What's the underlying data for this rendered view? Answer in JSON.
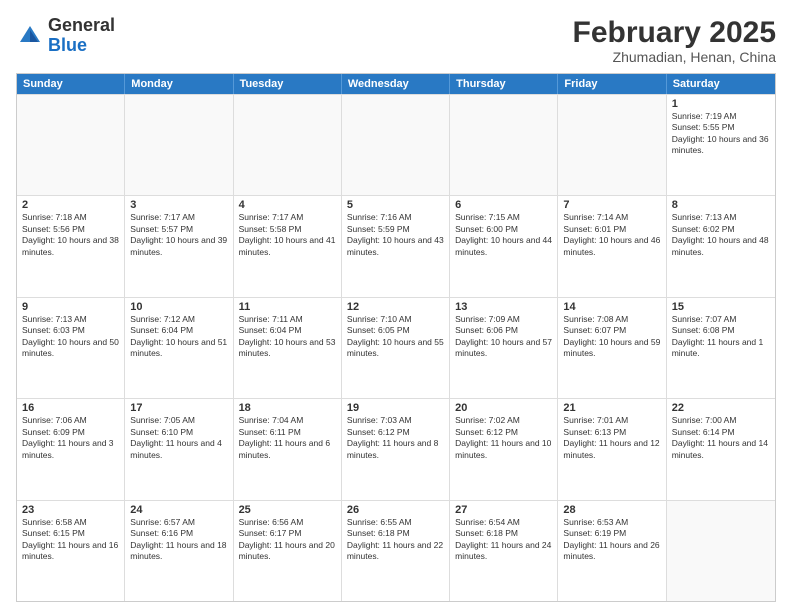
{
  "header": {
    "logo_general": "General",
    "logo_blue": "Blue",
    "month_year": "February 2025",
    "location": "Zhumadian, Henan, China"
  },
  "weekdays": [
    "Sunday",
    "Monday",
    "Tuesday",
    "Wednesday",
    "Thursday",
    "Friday",
    "Saturday"
  ],
  "rows": [
    [
      {
        "day": "",
        "info": ""
      },
      {
        "day": "",
        "info": ""
      },
      {
        "day": "",
        "info": ""
      },
      {
        "day": "",
        "info": ""
      },
      {
        "day": "",
        "info": ""
      },
      {
        "day": "",
        "info": ""
      },
      {
        "day": "1",
        "info": "Sunrise: 7:19 AM\nSunset: 5:55 PM\nDaylight: 10 hours and 36 minutes."
      }
    ],
    [
      {
        "day": "2",
        "info": "Sunrise: 7:18 AM\nSunset: 5:56 PM\nDaylight: 10 hours and 38 minutes."
      },
      {
        "day": "3",
        "info": "Sunrise: 7:17 AM\nSunset: 5:57 PM\nDaylight: 10 hours and 39 minutes."
      },
      {
        "day": "4",
        "info": "Sunrise: 7:17 AM\nSunset: 5:58 PM\nDaylight: 10 hours and 41 minutes."
      },
      {
        "day": "5",
        "info": "Sunrise: 7:16 AM\nSunset: 5:59 PM\nDaylight: 10 hours and 43 minutes."
      },
      {
        "day": "6",
        "info": "Sunrise: 7:15 AM\nSunset: 6:00 PM\nDaylight: 10 hours and 44 minutes."
      },
      {
        "day": "7",
        "info": "Sunrise: 7:14 AM\nSunset: 6:01 PM\nDaylight: 10 hours and 46 minutes."
      },
      {
        "day": "8",
        "info": "Sunrise: 7:13 AM\nSunset: 6:02 PM\nDaylight: 10 hours and 48 minutes."
      }
    ],
    [
      {
        "day": "9",
        "info": "Sunrise: 7:13 AM\nSunset: 6:03 PM\nDaylight: 10 hours and 50 minutes."
      },
      {
        "day": "10",
        "info": "Sunrise: 7:12 AM\nSunset: 6:04 PM\nDaylight: 10 hours and 51 minutes."
      },
      {
        "day": "11",
        "info": "Sunrise: 7:11 AM\nSunset: 6:04 PM\nDaylight: 10 hours and 53 minutes."
      },
      {
        "day": "12",
        "info": "Sunrise: 7:10 AM\nSunset: 6:05 PM\nDaylight: 10 hours and 55 minutes."
      },
      {
        "day": "13",
        "info": "Sunrise: 7:09 AM\nSunset: 6:06 PM\nDaylight: 10 hours and 57 minutes."
      },
      {
        "day": "14",
        "info": "Sunrise: 7:08 AM\nSunset: 6:07 PM\nDaylight: 10 hours and 59 minutes."
      },
      {
        "day": "15",
        "info": "Sunrise: 7:07 AM\nSunset: 6:08 PM\nDaylight: 11 hours and 1 minute."
      }
    ],
    [
      {
        "day": "16",
        "info": "Sunrise: 7:06 AM\nSunset: 6:09 PM\nDaylight: 11 hours and 3 minutes."
      },
      {
        "day": "17",
        "info": "Sunrise: 7:05 AM\nSunset: 6:10 PM\nDaylight: 11 hours and 4 minutes."
      },
      {
        "day": "18",
        "info": "Sunrise: 7:04 AM\nSunset: 6:11 PM\nDaylight: 11 hours and 6 minutes."
      },
      {
        "day": "19",
        "info": "Sunrise: 7:03 AM\nSunset: 6:12 PM\nDaylight: 11 hours and 8 minutes."
      },
      {
        "day": "20",
        "info": "Sunrise: 7:02 AM\nSunset: 6:12 PM\nDaylight: 11 hours and 10 minutes."
      },
      {
        "day": "21",
        "info": "Sunrise: 7:01 AM\nSunset: 6:13 PM\nDaylight: 11 hours and 12 minutes."
      },
      {
        "day": "22",
        "info": "Sunrise: 7:00 AM\nSunset: 6:14 PM\nDaylight: 11 hours and 14 minutes."
      }
    ],
    [
      {
        "day": "23",
        "info": "Sunrise: 6:58 AM\nSunset: 6:15 PM\nDaylight: 11 hours and 16 minutes."
      },
      {
        "day": "24",
        "info": "Sunrise: 6:57 AM\nSunset: 6:16 PM\nDaylight: 11 hours and 18 minutes."
      },
      {
        "day": "25",
        "info": "Sunrise: 6:56 AM\nSunset: 6:17 PM\nDaylight: 11 hours and 20 minutes."
      },
      {
        "day": "26",
        "info": "Sunrise: 6:55 AM\nSunset: 6:18 PM\nDaylight: 11 hours and 22 minutes."
      },
      {
        "day": "27",
        "info": "Sunrise: 6:54 AM\nSunset: 6:18 PM\nDaylight: 11 hours and 24 minutes."
      },
      {
        "day": "28",
        "info": "Sunrise: 6:53 AM\nSunset: 6:19 PM\nDaylight: 11 hours and 26 minutes."
      },
      {
        "day": "",
        "info": ""
      }
    ]
  ]
}
